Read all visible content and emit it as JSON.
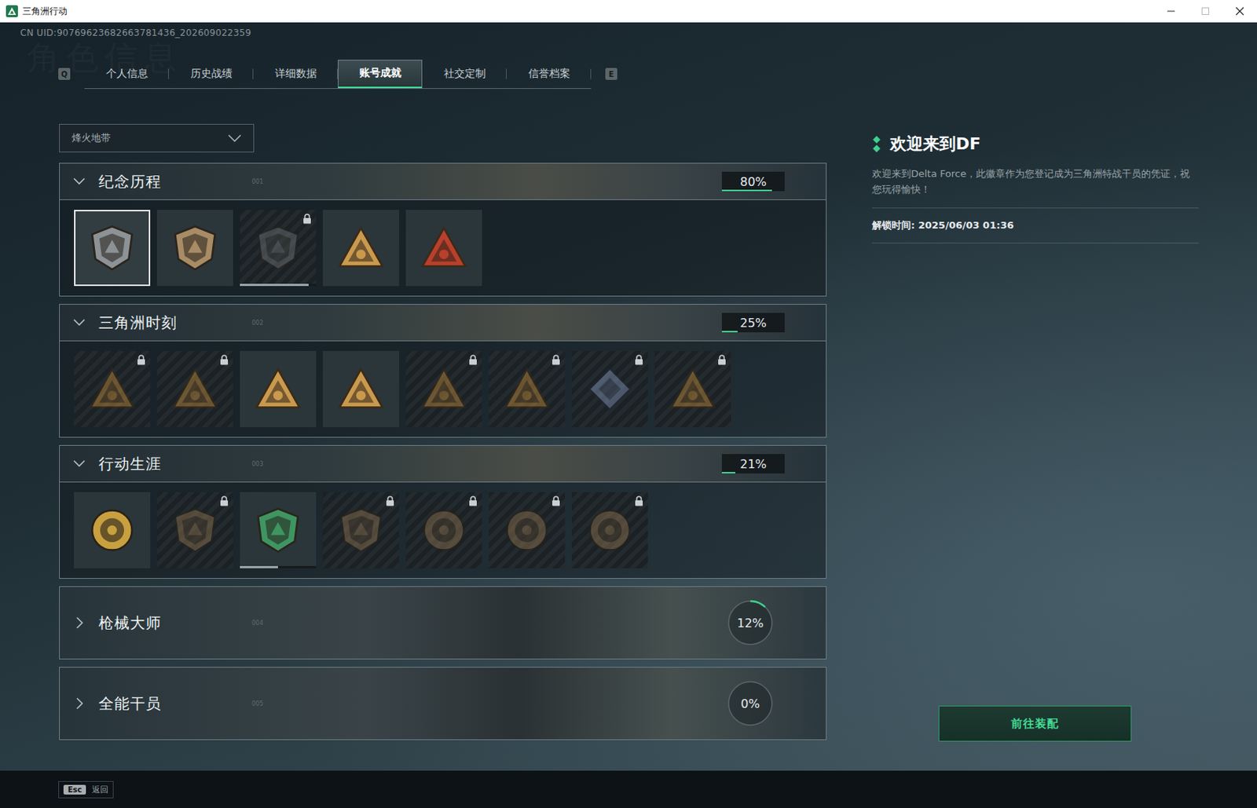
{
  "window": {
    "title": "三角洲行动"
  },
  "uid": "CN UID:90769623682663781436_202609022359",
  "watermark": "角色信息",
  "tab_keys": {
    "prev": "Q",
    "next": "E"
  },
  "tabs": [
    {
      "label": "个人信息",
      "selected": false
    },
    {
      "label": "历史战绩",
      "selected": false
    },
    {
      "label": "详细数据",
      "selected": false
    },
    {
      "label": "账号成就",
      "selected": true
    },
    {
      "label": "社交定制",
      "selected": false
    },
    {
      "label": "信誉档案",
      "selected": false
    }
  ],
  "mode_dropdown": {
    "value": "烽火地带"
  },
  "sections": [
    {
      "title": "纪念历程",
      "index": "001",
      "percent": "80%",
      "level": 0.8,
      "expanded": true,
      "badges": [
        {
          "kind": "shield",
          "color": "#8d9296",
          "locked": false,
          "selected": true
        },
        {
          "kind": "shield",
          "color": "#a88c66",
          "locked": false,
          "selected": false
        },
        {
          "kind": "shield",
          "color": "#6a6d72",
          "locked": true,
          "selected": false,
          "level": 0.9
        },
        {
          "kind": "triangle",
          "color": "#c99a4e",
          "locked": false,
          "selected": false
        },
        {
          "kind": "triangle",
          "color": "#b8402c",
          "locked": false,
          "selected": false
        }
      ]
    },
    {
      "title": "三角洲时刻",
      "index": "002",
      "percent": "25%",
      "level": 0.25,
      "expanded": true,
      "badges": [
        {
          "kind": "triangle",
          "color": "#b8863a",
          "locked": true,
          "selected": false
        },
        {
          "kind": "triangle",
          "color": "#b8863a",
          "locked": true,
          "selected": false
        },
        {
          "kind": "triangle",
          "color": "#c99a4e",
          "locked": false,
          "selected": false
        },
        {
          "kind": "triangle",
          "color": "#c99a4e",
          "locked": false,
          "selected": false
        },
        {
          "kind": "triangle",
          "color": "#b8863a",
          "locked": true,
          "selected": false
        },
        {
          "kind": "triangle",
          "color": "#b8863a",
          "locked": true,
          "selected": false
        },
        {
          "kind": "diamond",
          "color": "#7d8fae",
          "locked": true,
          "selected": false
        },
        {
          "kind": "triangle",
          "color": "#b8863a",
          "locked": true,
          "selected": false
        }
      ]
    },
    {
      "title": "行动生涯",
      "index": "003",
      "percent": "21%",
      "level": 0.21,
      "expanded": true,
      "badges": [
        {
          "kind": "round",
          "color": "#c9a040",
          "locked": false,
          "selected": false
        },
        {
          "kind": "shield",
          "color": "#8a7050",
          "locked": true,
          "selected": false
        },
        {
          "kind": "shield",
          "color": "#3f9562",
          "locked": false,
          "selected": false,
          "level": 0.5
        },
        {
          "kind": "shield",
          "color": "#8a7050",
          "locked": true,
          "selected": false
        },
        {
          "kind": "round",
          "color": "#8a7050",
          "locked": true,
          "selected": false
        },
        {
          "kind": "round",
          "color": "#8a7050",
          "locked": true,
          "selected": false
        },
        {
          "kind": "round",
          "color": "#8a7050",
          "locked": true,
          "selected": false
        }
      ]
    },
    {
      "title": "枪械大师",
      "index": "004",
      "percent": "12%",
      "level": 0.12,
      "expanded": false,
      "badges": []
    },
    {
      "title": "全能干员",
      "index": "005",
      "percent": "0%",
      "level": 0,
      "expanded": false,
      "badges": []
    }
  ],
  "detail": {
    "title": "欢迎来到DF",
    "description": "欢迎来到Delta Force，此徽章作为您登记成为三角洲特战干员的凭证，祝您玩得愉快！",
    "unlock_time": "解锁时间: 2025/06/03 01:36"
  },
  "equip_button": {
    "label": "前往装配"
  },
  "footer": {
    "key": "Esc",
    "label": "返回"
  }
}
